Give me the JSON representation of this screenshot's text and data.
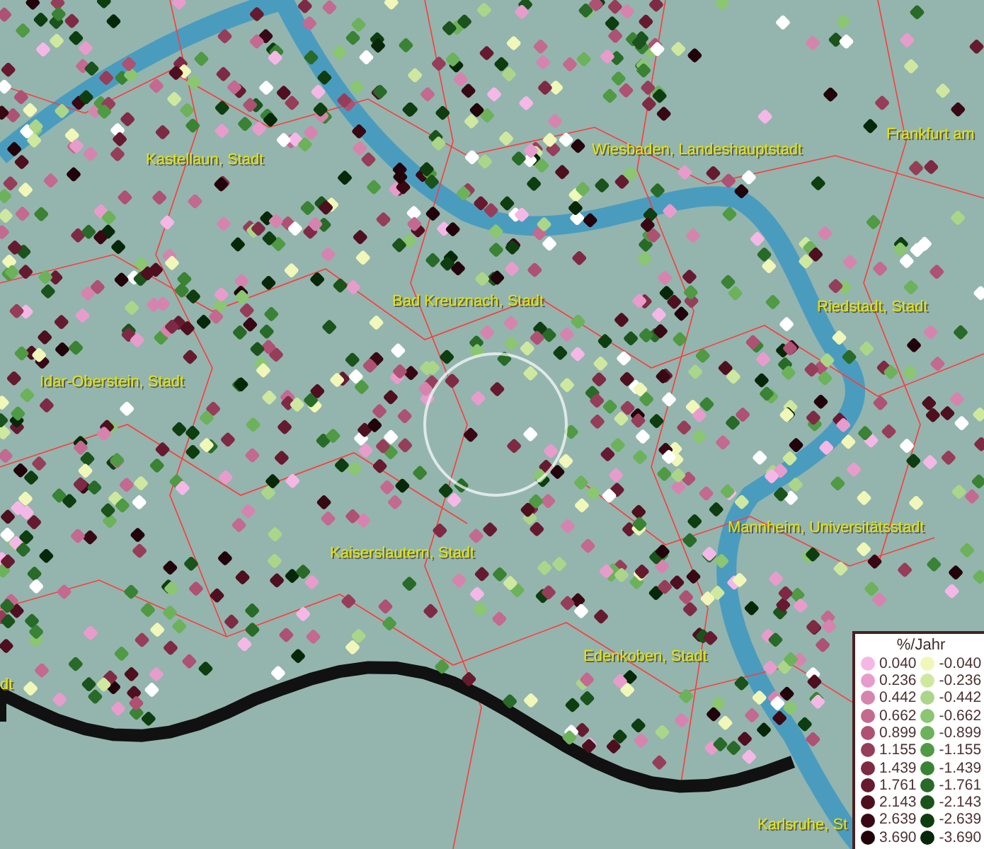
{
  "map": {
    "place_labels": [
      {
        "text": "Kastellaun, Stadt"
      },
      {
        "text": "Wiesbaden, Landeshauptstadt"
      },
      {
        "text": "Frankfurt am"
      },
      {
        "text": "Bad Kreuznach, Stadt"
      },
      {
        "text": "Riedstadt, Stadt"
      },
      {
        "text": "Idar-Oberstein, Stadt"
      },
      {
        "text": "Kaiserslautern, Stadt"
      },
      {
        "text": "Mannheim, Universitätsstadt"
      },
      {
        "text": "Edenkoben, Stadt"
      },
      {
        "text": "dt"
      },
      {
        "text": "Karlsruhe, St"
      }
    ]
  },
  "legend": {
    "title": "%/Jahr",
    "positive": [
      {
        "label": "0.040",
        "color": "#f5b8e6"
      },
      {
        "label": "0.236",
        "color": "#e89ccb"
      },
      {
        "label": "0.442",
        "color": "#d684ae"
      },
      {
        "label": "0.662",
        "color": "#c46990"
      },
      {
        "label": "0.899",
        "color": "#ae5173"
      },
      {
        "label": "1.155",
        "color": "#963d5a"
      },
      {
        "label": "1.439",
        "color": "#7e2a44"
      },
      {
        "label": "1.761",
        "color": "#661a30"
      },
      {
        "label": "2.143",
        "color": "#4e0f1f"
      },
      {
        "label": "2.639",
        "color": "#380815"
      },
      {
        "label": "3.690",
        "color": "#22030b"
      }
    ],
    "negative": [
      {
        "label": "-0.040",
        "color": "#f0f7b8"
      },
      {
        "label": "-0.236",
        "color": "#cfe8a0"
      },
      {
        "label": "-0.442",
        "color": "#abd689"
      },
      {
        "label": "-0.662",
        "color": "#8bc670"
      },
      {
        "label": "-0.899",
        "color": "#6cb25a"
      },
      {
        "label": "-1.155",
        "color": "#4f9a43"
      },
      {
        "label": "-1.439",
        "color": "#3a8234"
      },
      {
        "label": "-1.761",
        "color": "#286a27"
      },
      {
        "label": "-2.143",
        "color": "#1a531b"
      },
      {
        "label": "-2.639",
        "color": "#0e3d10"
      },
      {
        "label": "-3.690",
        "color": "#062808"
      }
    ]
  }
}
